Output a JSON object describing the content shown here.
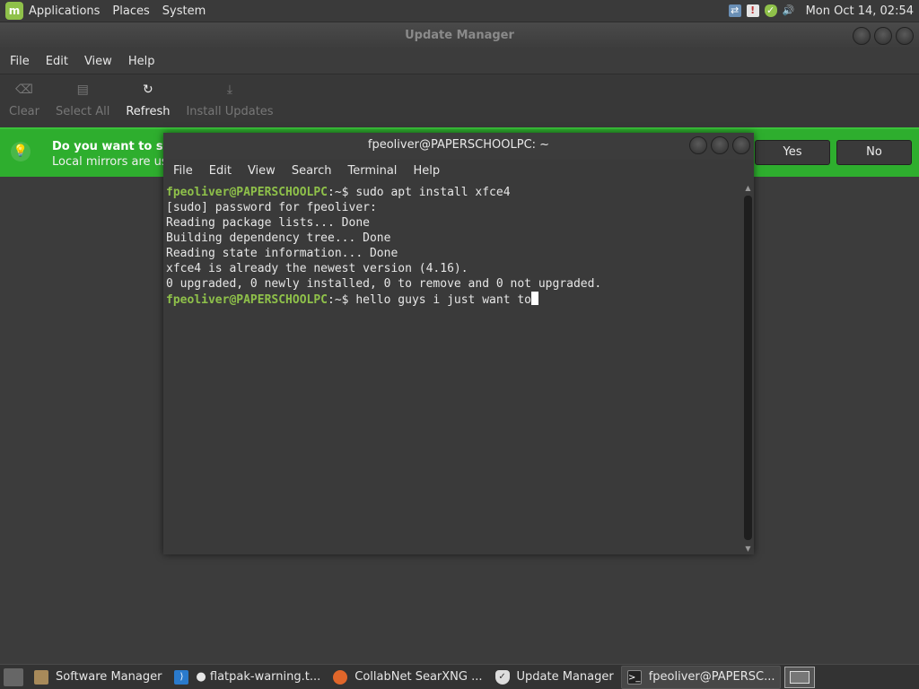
{
  "top_panel": {
    "menus": [
      "Applications",
      "Places",
      "System"
    ],
    "clock": "Mon Oct 14, 02:54"
  },
  "update_manager": {
    "title": "Update Manager",
    "menu": [
      "File",
      "Edit",
      "View",
      "Help"
    ],
    "toolbar": {
      "clear": "Clear",
      "select_all": "Select All",
      "refresh": "Refresh",
      "install_updates": "Install Updates"
    },
    "infobar": {
      "title": "Do you want to swit",
      "subtitle": "Local mirrors are usu",
      "yes": "Yes",
      "no": "No"
    }
  },
  "terminal": {
    "title": "fpeoliver@PAPERSCHOOLPC: ~",
    "menu": [
      "File",
      "Edit",
      "View",
      "Search",
      "Terminal",
      "Help"
    ],
    "prompt_user": "fpeoliver@PAPERSCHOOLPC",
    "prompt_suffix": ":~$ ",
    "lines": [
      {
        "type": "cmd",
        "text": "sudo apt install xfce4"
      },
      {
        "type": "out",
        "text": "[sudo] password for fpeoliver:"
      },
      {
        "type": "out",
        "text": "Reading package lists... Done"
      },
      {
        "type": "out",
        "text": "Building dependency tree... Done"
      },
      {
        "type": "out",
        "text": "Reading state information... Done"
      },
      {
        "type": "out",
        "text": "xfce4 is already the newest version (4.16)."
      },
      {
        "type": "out",
        "text": "0 upgraded, 0 newly installed, 0 to remove and 0 not upgraded."
      },
      {
        "type": "cmd",
        "text": "hello guys i just want to"
      }
    ]
  },
  "taskbar": {
    "items": [
      {
        "label": "Software Manager",
        "icon": "software-manager-icon"
      },
      {
        "label": "● flatpak-warning.t...",
        "icon": "vscode-icon"
      },
      {
        "label": "CollabNet SearXNG ...",
        "icon": "firefox-icon"
      },
      {
        "label": "Update Manager",
        "icon": "shield-icon"
      },
      {
        "label": "fpeoliver@PAPERSC...",
        "icon": "terminal-icon"
      }
    ]
  }
}
